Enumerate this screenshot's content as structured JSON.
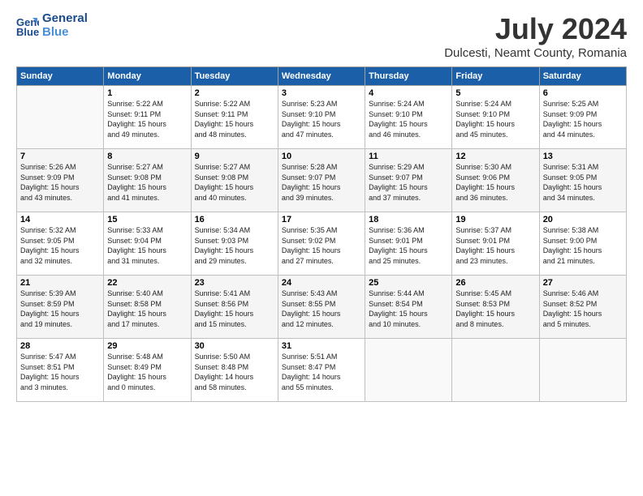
{
  "logo": {
    "line1": "General",
    "line2": "Blue"
  },
  "title": "July 2024",
  "subtitle": "Dulcesti, Neamt County, Romania",
  "weekdays": [
    "Sunday",
    "Monday",
    "Tuesday",
    "Wednesday",
    "Thursday",
    "Friday",
    "Saturday"
  ],
  "weeks": [
    [
      {
        "day": "",
        "content": ""
      },
      {
        "day": "1",
        "content": "Sunrise: 5:22 AM\nSunset: 9:11 PM\nDaylight: 15 hours\nand 49 minutes."
      },
      {
        "day": "2",
        "content": "Sunrise: 5:22 AM\nSunset: 9:11 PM\nDaylight: 15 hours\nand 48 minutes."
      },
      {
        "day": "3",
        "content": "Sunrise: 5:23 AM\nSunset: 9:10 PM\nDaylight: 15 hours\nand 47 minutes."
      },
      {
        "day": "4",
        "content": "Sunrise: 5:24 AM\nSunset: 9:10 PM\nDaylight: 15 hours\nand 46 minutes."
      },
      {
        "day": "5",
        "content": "Sunrise: 5:24 AM\nSunset: 9:10 PM\nDaylight: 15 hours\nand 45 minutes."
      },
      {
        "day": "6",
        "content": "Sunrise: 5:25 AM\nSunset: 9:09 PM\nDaylight: 15 hours\nand 44 minutes."
      }
    ],
    [
      {
        "day": "7",
        "content": "Sunrise: 5:26 AM\nSunset: 9:09 PM\nDaylight: 15 hours\nand 43 minutes."
      },
      {
        "day": "8",
        "content": "Sunrise: 5:27 AM\nSunset: 9:08 PM\nDaylight: 15 hours\nand 41 minutes."
      },
      {
        "day": "9",
        "content": "Sunrise: 5:27 AM\nSunset: 9:08 PM\nDaylight: 15 hours\nand 40 minutes."
      },
      {
        "day": "10",
        "content": "Sunrise: 5:28 AM\nSunset: 9:07 PM\nDaylight: 15 hours\nand 39 minutes."
      },
      {
        "day": "11",
        "content": "Sunrise: 5:29 AM\nSunset: 9:07 PM\nDaylight: 15 hours\nand 37 minutes."
      },
      {
        "day": "12",
        "content": "Sunrise: 5:30 AM\nSunset: 9:06 PM\nDaylight: 15 hours\nand 36 minutes."
      },
      {
        "day": "13",
        "content": "Sunrise: 5:31 AM\nSunset: 9:05 PM\nDaylight: 15 hours\nand 34 minutes."
      }
    ],
    [
      {
        "day": "14",
        "content": "Sunrise: 5:32 AM\nSunset: 9:05 PM\nDaylight: 15 hours\nand 32 minutes."
      },
      {
        "day": "15",
        "content": "Sunrise: 5:33 AM\nSunset: 9:04 PM\nDaylight: 15 hours\nand 31 minutes."
      },
      {
        "day": "16",
        "content": "Sunrise: 5:34 AM\nSunset: 9:03 PM\nDaylight: 15 hours\nand 29 minutes."
      },
      {
        "day": "17",
        "content": "Sunrise: 5:35 AM\nSunset: 9:02 PM\nDaylight: 15 hours\nand 27 minutes."
      },
      {
        "day": "18",
        "content": "Sunrise: 5:36 AM\nSunset: 9:01 PM\nDaylight: 15 hours\nand 25 minutes."
      },
      {
        "day": "19",
        "content": "Sunrise: 5:37 AM\nSunset: 9:01 PM\nDaylight: 15 hours\nand 23 minutes."
      },
      {
        "day": "20",
        "content": "Sunrise: 5:38 AM\nSunset: 9:00 PM\nDaylight: 15 hours\nand 21 minutes."
      }
    ],
    [
      {
        "day": "21",
        "content": "Sunrise: 5:39 AM\nSunset: 8:59 PM\nDaylight: 15 hours\nand 19 minutes."
      },
      {
        "day": "22",
        "content": "Sunrise: 5:40 AM\nSunset: 8:58 PM\nDaylight: 15 hours\nand 17 minutes."
      },
      {
        "day": "23",
        "content": "Sunrise: 5:41 AM\nSunset: 8:56 PM\nDaylight: 15 hours\nand 15 minutes."
      },
      {
        "day": "24",
        "content": "Sunrise: 5:43 AM\nSunset: 8:55 PM\nDaylight: 15 hours\nand 12 minutes."
      },
      {
        "day": "25",
        "content": "Sunrise: 5:44 AM\nSunset: 8:54 PM\nDaylight: 15 hours\nand 10 minutes."
      },
      {
        "day": "26",
        "content": "Sunrise: 5:45 AM\nSunset: 8:53 PM\nDaylight: 15 hours\nand 8 minutes."
      },
      {
        "day": "27",
        "content": "Sunrise: 5:46 AM\nSunset: 8:52 PM\nDaylight: 15 hours\nand 5 minutes."
      }
    ],
    [
      {
        "day": "28",
        "content": "Sunrise: 5:47 AM\nSunset: 8:51 PM\nDaylight: 15 hours\nand 3 minutes."
      },
      {
        "day": "29",
        "content": "Sunrise: 5:48 AM\nSunset: 8:49 PM\nDaylight: 15 hours\nand 0 minutes."
      },
      {
        "day": "30",
        "content": "Sunrise: 5:50 AM\nSunset: 8:48 PM\nDaylight: 14 hours\nand 58 minutes."
      },
      {
        "day": "31",
        "content": "Sunrise: 5:51 AM\nSunset: 8:47 PM\nDaylight: 14 hours\nand 55 minutes."
      },
      {
        "day": "",
        "content": ""
      },
      {
        "day": "",
        "content": ""
      },
      {
        "day": "",
        "content": ""
      }
    ]
  ]
}
